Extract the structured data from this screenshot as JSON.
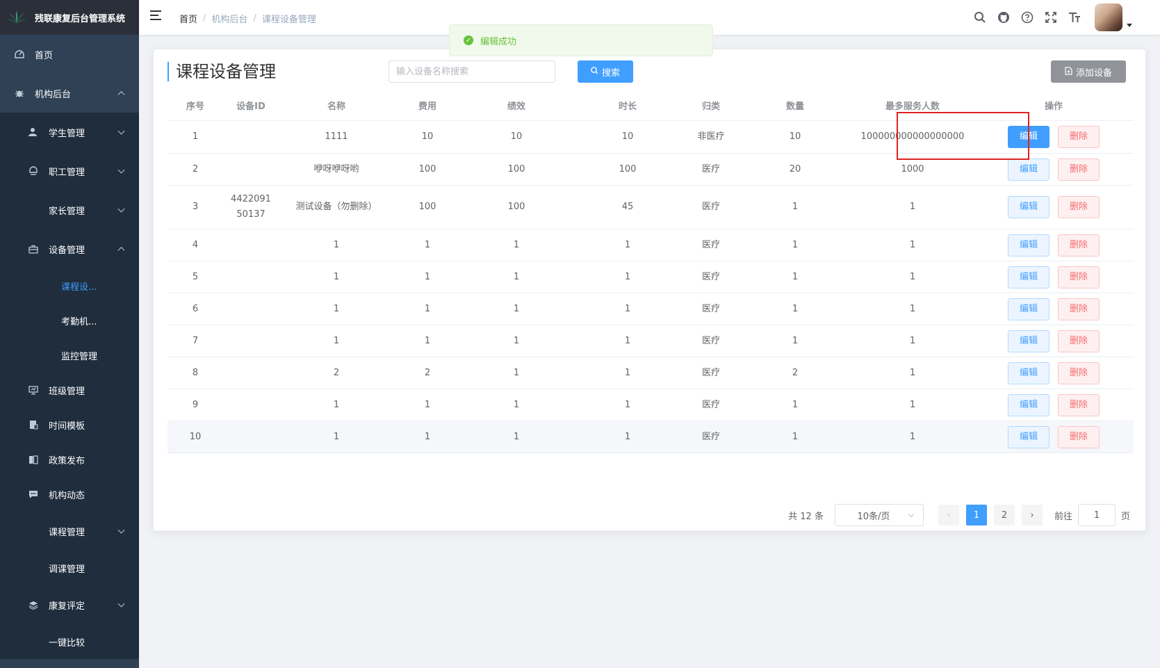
{
  "app": {
    "title": "残联康复后台管理系统"
  },
  "sidebar": {
    "items": [
      {
        "label": "首页",
        "icon": "dashboard-icon"
      },
      {
        "label": "机构后台",
        "icon": "bug-icon"
      },
      {
        "label": "学生管理",
        "icon": "user-icon"
      },
      {
        "label": "职工管理",
        "icon": "peoples-icon"
      },
      {
        "label": "家长管理"
      },
      {
        "label": "设备管理",
        "icon": "briefcase-icon"
      },
      {
        "label": "课程设..."
      },
      {
        "label": "考勤机..."
      },
      {
        "label": "监控管理"
      },
      {
        "label": "班级管理",
        "icon": "monitor-icon"
      },
      {
        "label": "时间模板",
        "icon": "document-icon"
      },
      {
        "label": "政策发布",
        "icon": "book-icon"
      },
      {
        "label": "机构动态",
        "icon": "message-icon"
      },
      {
        "label": "课程管理"
      },
      {
        "label": "调课管理"
      },
      {
        "label": "康复评定",
        "icon": "layers-icon"
      },
      {
        "label": "一键比较"
      }
    ]
  },
  "breadcrumb": [
    "首页",
    "机构后台",
    "课程设备管理"
  ],
  "toast": {
    "message": "编辑成功"
  },
  "page": {
    "title": "课程设备管理",
    "search_placeholder": "输入设备名称搜索",
    "search_label": "搜索",
    "add_label": "添加设备"
  },
  "table": {
    "columns": [
      "序号",
      "设备ID",
      "名称",
      "费用",
      "绩效",
      "时长",
      "归类",
      "数量",
      "最多服务人数",
      "操作"
    ],
    "rows": [
      {
        "index": "1",
        "device_id": "",
        "name": "1111",
        "fee": "10",
        "perf": "10",
        "duration": "10",
        "category": "非医疗",
        "qty": "10",
        "max_serve": "100000000000000000"
      },
      {
        "index": "2",
        "device_id": "",
        "name": "咿呀咿呀哟",
        "fee": "100",
        "perf": "100",
        "duration": "100",
        "category": "医疗",
        "qty": "20",
        "max_serve": "1000"
      },
      {
        "index": "3",
        "device_id": "4422091 50137",
        "name": "测试设备（勿删除）",
        "fee": "100",
        "perf": "100",
        "duration": "45",
        "category": "医疗",
        "qty": "1",
        "max_serve": "1"
      },
      {
        "index": "4",
        "device_id": "",
        "name": "1",
        "fee": "1",
        "perf": "1",
        "duration": "1",
        "category": "医疗",
        "qty": "1",
        "max_serve": "1"
      },
      {
        "index": "5",
        "device_id": "",
        "name": "1",
        "fee": "1",
        "perf": "1",
        "duration": "1",
        "category": "医疗",
        "qty": "1",
        "max_serve": "1"
      },
      {
        "index": "6",
        "device_id": "",
        "name": "1",
        "fee": "1",
        "perf": "1",
        "duration": "1",
        "category": "医疗",
        "qty": "1",
        "max_serve": "1"
      },
      {
        "index": "7",
        "device_id": "",
        "name": "1",
        "fee": "1",
        "perf": "1",
        "duration": "1",
        "category": "医疗",
        "qty": "1",
        "max_serve": "1"
      },
      {
        "index": "8",
        "device_id": "",
        "name": "2",
        "fee": "2",
        "perf": "1",
        "duration": "1",
        "category": "医疗",
        "qty": "2",
        "max_serve": "1"
      },
      {
        "index": "9",
        "device_id": "",
        "name": "1",
        "fee": "1",
        "perf": "1",
        "duration": "1",
        "category": "医疗",
        "qty": "1",
        "max_serve": "1"
      },
      {
        "index": "10",
        "device_id": "",
        "name": "1",
        "fee": "1",
        "perf": "1",
        "duration": "1",
        "category": "医疗",
        "qty": "1",
        "max_serve": "1"
      }
    ],
    "edit_label": "编辑",
    "delete_label": "删除"
  },
  "pagination": {
    "total_text": "共 12 条",
    "page_size": "10条/页",
    "pages": [
      "1",
      "2"
    ],
    "current": "1",
    "goto_prefix": "前往",
    "goto_value": "1",
    "goto_suffix": "页"
  },
  "colors": {
    "primary": "#409eff",
    "sidebar": "#304156",
    "success": "#67c23a",
    "danger": "#f56c6c",
    "highlight": "#e02020"
  }
}
